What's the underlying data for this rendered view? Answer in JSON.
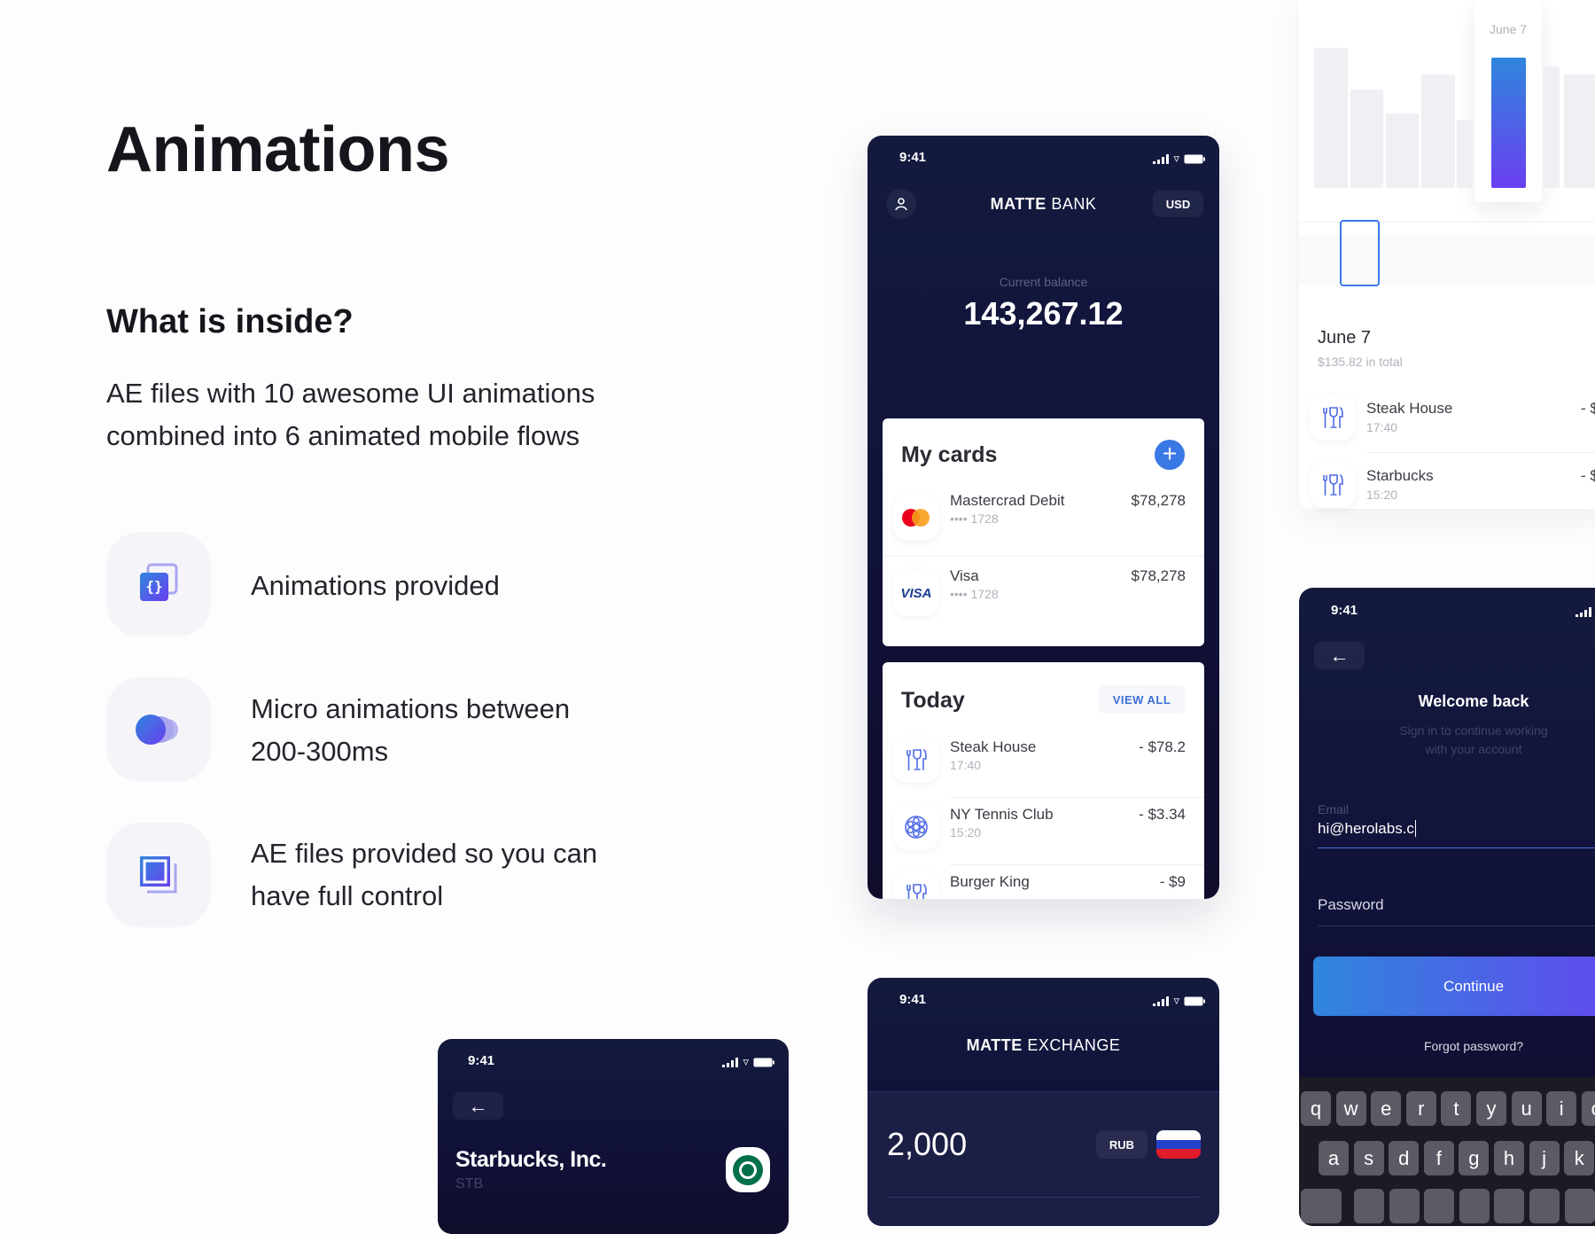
{
  "page": {
    "title": "Animations",
    "subtitle": "What is inside?",
    "description_lines": [
      "AE files with 10 awesome  UI animations",
      "combined into 6 animated mobile flows"
    ],
    "features": [
      {
        "icon": "code-brackets-icon",
        "lines": [
          "Animations provided"
        ]
      },
      {
        "icon": "motion-circles-icon",
        "lines": [
          "Micro animations between",
          "200-300ms"
        ]
      },
      {
        "icon": "layers-square-icon",
        "lines": [
          "AE files provided so you can",
          "have full control"
        ]
      }
    ],
    "accent_gradient": [
      "#2f86dd",
      "#6a3ff0"
    ]
  },
  "bank_phone": {
    "time": "9:41",
    "brand_bold": "MATTE",
    "brand_light": "BANK",
    "currency": "USD",
    "balance_label": "Current balance",
    "balance": "143,267.12",
    "cards": {
      "title": "My cards",
      "items": [
        {
          "name": "Mastercrad Debit",
          "number": "•••• 1728",
          "amount": "$78,278",
          "icon": "mastercard-icon"
        },
        {
          "name": "Visa",
          "number": "•••• 1728",
          "amount": "$78,278",
          "icon": "visa-icon",
          "logo_text": "VISA"
        }
      ]
    },
    "today": {
      "title": "Today",
      "view_all": "VIEW ALL",
      "items": [
        {
          "name": "Steak House",
          "time": "17:40",
          "amount": "- $78.2",
          "icon": "restaurant-icon"
        },
        {
          "name": "NY Tennis Club",
          "time": "15:20",
          "amount": "- $3.34",
          "icon": "ball-icon"
        },
        {
          "name": "Burger King",
          "time": "",
          "amount": "- $9",
          "icon": "restaurant-icon"
        }
      ]
    }
  },
  "stats_card": {
    "tooltip_label": "June 7",
    "bar_values": [
      100,
      70,
      53,
      81,
      49,
      93,
      87,
      81
    ],
    "highlighted_index": 5,
    "date": "June 7",
    "total": "$135.82 in total",
    "items": [
      {
        "name": "Steak House",
        "time": "17:40",
        "amount": "- $"
      },
      {
        "name": "Starbucks",
        "time": "15:20",
        "amount": "- $"
      }
    ]
  },
  "login_phone": {
    "time": "9:41",
    "title": "Welcome back",
    "subtitle_lines": [
      "Sign in to continue working",
      "with your account"
    ],
    "email_label": "Email",
    "email_value": "hi@herolabs.c",
    "password_label": "Password",
    "continue": "Continue",
    "forgot": "Forgot password?",
    "keyboard_rows": [
      [
        "q",
        "w",
        "e",
        "r",
        "t",
        "y",
        "u",
        "i",
        "o"
      ],
      [
        "a",
        "s",
        "d",
        "f",
        "g",
        "h",
        "j",
        "k"
      ]
    ]
  },
  "stock_phone": {
    "time": "9:41",
    "company": "Starbucks, Inc.",
    "ticker": "STB"
  },
  "exchange_phone": {
    "time": "9:41",
    "brand_bold": "MATTE",
    "brand_light": "EXCHANGE",
    "amount": "2,000",
    "currency": "RUB"
  }
}
